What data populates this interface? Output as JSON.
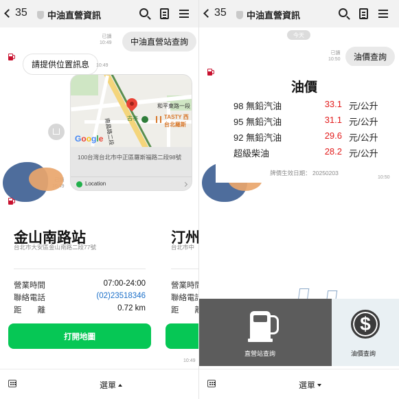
{
  "header": {
    "back_count": "35",
    "title": "中油直營資訊"
  },
  "left": {
    "chat": {
      "user_msg": "中油直營站查詢",
      "user_meta_read": "已讀",
      "user_meta_time": "10:49",
      "bot_prompt": "請提供位置訊息",
      "bot_prompt_time": "10:49",
      "loc_meta_read": "已讀",
      "loc_meta_time": "10:49",
      "map_labels": {
        "road1": "和平東路一段",
        "road2": "南昌路二段",
        "station": "古亭",
        "shop1": "TASTY 西",
        "shop2": "台北羅斯",
        "google": "Google"
      },
      "location_address": "100台灣台北市中正區羅斯福路二段98號",
      "location_label": "Location"
    },
    "stations": [
      {
        "name": "金山南路站",
        "address": "台北市大安區金山南路二段77號",
        "hours_label": "營業時間",
        "hours": "07:00-24:00",
        "phone_label": "聯絡電話",
        "phone": "(02)23518346",
        "dist_label": "距　　離",
        "distance": "0.72 km",
        "button": "打開地圖"
      },
      {
        "name": "汀州",
        "address": "台北市中",
        "hours_label": "營業時間",
        "phone_label": "聯絡電話",
        "dist_label": "距　　離"
      }
    ],
    "card_time": "10:49",
    "menu_label": "選單"
  },
  "right": {
    "date_pill": "今天",
    "chat": {
      "user_msg": "油價查詢",
      "user_meta_read": "已讀",
      "user_meta_time": "10:50"
    },
    "price_card": {
      "title": "油價",
      "rows": [
        {
          "name": "98 無鉛汽油",
          "price": "33.1",
          "unit": "元/公升"
        },
        {
          "name": "95 無鉛汽油",
          "price": "31.1",
          "unit": "元/公升"
        },
        {
          "name": "92 無鉛汽油",
          "price": "29.6",
          "unit": "元/公升"
        },
        {
          "name": "超級柴油",
          "price": "28.2",
          "unit": "元/公升"
        }
      ],
      "effective": "牌價生效日期： 20250203",
      "time": "10:50"
    },
    "rich_menu": {
      "station_query": "直營站查詢",
      "price_query": "油價查詢"
    },
    "menu_label": "選單"
  },
  "colors": {
    "line_green": "#06c755",
    "price_red": "#e21b1b",
    "link_blue": "#1a6fc9",
    "cpc_red": "#c8102e"
  },
  "icons": [
    "back-chevron-icon",
    "shield-icon",
    "search-icon",
    "note-icon",
    "menu-icon",
    "gas-pump-icon",
    "dollar-icon",
    "keyboard-icon",
    "share-icon",
    "location-pin-icon"
  ]
}
